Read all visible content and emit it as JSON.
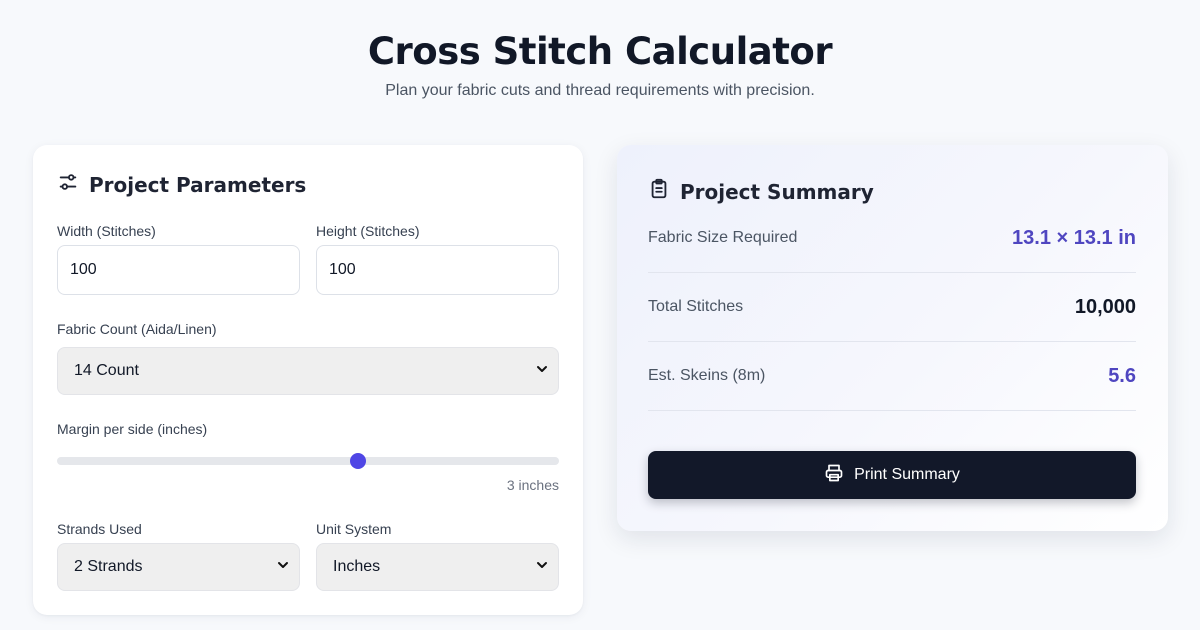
{
  "header": {
    "title": "Cross Stitch Calculator",
    "subtitle": "Plan your fabric cuts and thread requirements with precision."
  },
  "parameters": {
    "title": "Project Parameters",
    "width": {
      "label": "Width (Stitches)",
      "value": "100"
    },
    "height": {
      "label": "Height (Stitches)",
      "value": "100"
    },
    "fabric_count": {
      "label": "Fabric Count (Aida/Linen)",
      "selected": "14 Count"
    },
    "margin": {
      "label": "Margin per side (inches)",
      "value_text": "3 inches",
      "fraction": 0.6
    },
    "strands": {
      "label": "Strands Used",
      "selected": "2 Strands"
    },
    "units": {
      "label": "Unit System",
      "selected": "Inches"
    }
  },
  "summary": {
    "title": "Project Summary",
    "rows": [
      {
        "label": "Fabric Size Required",
        "value": "13.1 × 13.1 in",
        "color": "#4f46c0"
      },
      {
        "label": "Total Stitches",
        "value": "10,000",
        "color": "#111827"
      },
      {
        "label": "Est. Skeins (8m)",
        "value": "5.6",
        "color": "#4f46c0"
      }
    ],
    "print_label": "Print Summary"
  },
  "icons": {
    "parameters": "sliders-icon",
    "summary": "clipboard-icon",
    "print": "printer-icon",
    "select": "chevron-down-icon"
  }
}
